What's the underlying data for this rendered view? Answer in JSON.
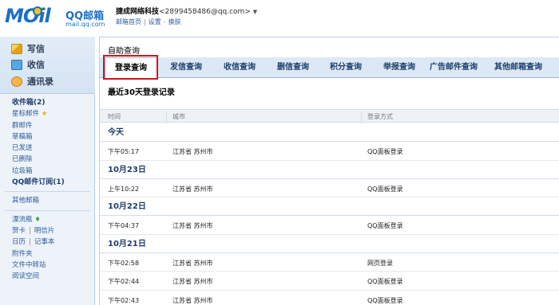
{
  "header": {
    "logo_mark": "MOil",
    "logo_name": "QQ邮箱",
    "logo_domain": "mail.qq.com",
    "account_name": "捷成网络科技",
    "account_email": "<2899458486@qq.com>",
    "links": [
      "邮箱首页",
      "设置",
      "换肤"
    ]
  },
  "sidebar": {
    "actions": [
      {
        "label": "写信",
        "icon": "write-icon"
      },
      {
        "label": "收信",
        "icon": "inbox-icon"
      },
      {
        "label": "通讯录",
        "icon": "contacts-icon"
      }
    ],
    "folders": [
      {
        "label": "收件箱(2)",
        "bold": true
      },
      {
        "label": "星标邮件",
        "icon": "star-icon"
      },
      {
        "label": "群邮件"
      },
      {
        "label": "草稿箱"
      },
      {
        "label": "已发送"
      },
      {
        "label": "已删除"
      },
      {
        "label": "垃圾箱"
      },
      {
        "label": "QQ邮件订阅(1)",
        "bold": true
      }
    ],
    "other_mailbox": "其他邮箱",
    "extras": {
      "drift_bottle": "漂流瓶",
      "greeting_card": "贺卡",
      "postcard": "明信片",
      "calendar": "日历",
      "notebook": "记事本",
      "attachments": "附件夹",
      "file_transfer": "文件中转站",
      "reading_space": "阅读空间"
    }
  },
  "main": {
    "title": "自助查询",
    "tabs": [
      {
        "label": "登录查询",
        "active": true
      },
      {
        "label": "发信查询"
      },
      {
        "label": "收信查询"
      },
      {
        "label": "删信查询"
      },
      {
        "label": "积分查询"
      },
      {
        "label": "举报查询"
      },
      {
        "label": "广告邮件查询"
      },
      {
        "label": "其他邮箱查询"
      }
    ],
    "subtitle": "最近30天登录记录",
    "columns": [
      "时间",
      "城市",
      "登录方式"
    ],
    "groups": [
      {
        "date": "今天",
        "rows": [
          {
            "time": "下午05:17",
            "city": "江苏省 苏州市",
            "method": "QQ面板登录"
          }
        ]
      },
      {
        "date": "10月23日",
        "rows": [
          {
            "time": "上午10:22",
            "city": "江苏省 苏州市",
            "method": "QQ面板登录"
          }
        ]
      },
      {
        "date": "10月22日",
        "rows": [
          {
            "time": "下午04:37",
            "city": "江苏省 苏州市",
            "method": "QQ面板登录"
          }
        ]
      },
      {
        "date": "10月21日",
        "rows": [
          {
            "time": "下午02:58",
            "city": "江苏省 苏州市",
            "method": "网页登录"
          },
          {
            "time": "下午02:44",
            "city": "江苏省 苏州市",
            "method": "QQ面板登录"
          },
          {
            "time": "下午02:43",
            "city": "江苏省 苏州市",
            "method": "QQ面板登录"
          }
        ]
      }
    ]
  },
  "colors": {
    "brand": "#1b6fc4",
    "link": "#2a5b9d",
    "highlight": "#d0141a",
    "tabbar": "#dce8f5"
  }
}
